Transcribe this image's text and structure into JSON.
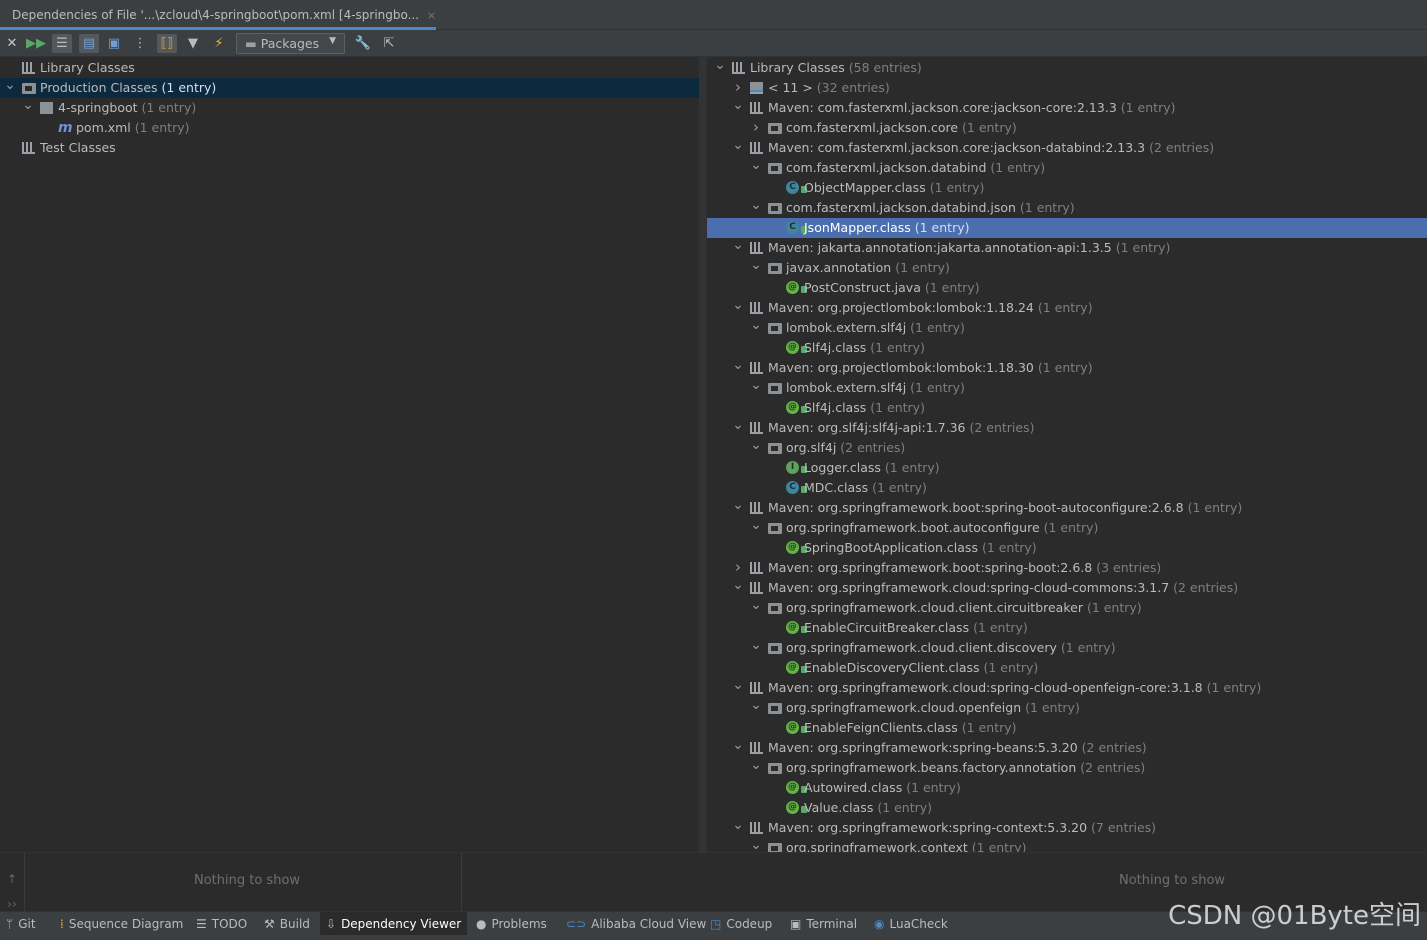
{
  "tab": {
    "title": "Dependencies of File '...\\zcloud\\4-springboot\\pom.xml [4-springbo...",
    "close": "×"
  },
  "toolbar": {
    "packages_label": "Packages"
  },
  "left_tree": [
    {
      "label": "Library Classes",
      "count": "",
      "level": 0,
      "arrow": "",
      "icon": "library"
    },
    {
      "label": "Production Classes",
      "count": "(1 entry)",
      "level": 0,
      "arrow": "down",
      "icon": "folder",
      "selected": true
    },
    {
      "label": "4-springboot",
      "count": "(1 entry)",
      "level": 1,
      "arrow": "down",
      "icon": "module"
    },
    {
      "label": "pom.xml",
      "count": "(1 entry)",
      "level": 2,
      "arrow": "",
      "icon": "maven"
    },
    {
      "label": "Test Classes",
      "count": "",
      "level": 0,
      "arrow": "",
      "icon": "library"
    }
  ],
  "right_tree": [
    {
      "label": "Library Classes",
      "count": "(58 entries)",
      "level": 0,
      "arrow": "down",
      "icon": "library"
    },
    {
      "label": "< 11 >",
      "count": "(32 entries)",
      "level": 1,
      "arrow": "right",
      "icon": "jdk"
    },
    {
      "label": "Maven: com.fasterxml.jackson.core:jackson-core:2.13.3",
      "count": "(1 entry)",
      "level": 1,
      "arrow": "down",
      "icon": "library"
    },
    {
      "label": "com.fasterxml.jackson.core",
      "count": "(1 entry)",
      "level": 2,
      "arrow": "right",
      "icon": "folder"
    },
    {
      "label": "Maven: com.fasterxml.jackson.core:jackson-databind:2.13.3",
      "count": "(2 entries)",
      "level": 1,
      "arrow": "down",
      "icon": "library"
    },
    {
      "label": "com.fasterxml.jackson.databind",
      "count": "(1 entry)",
      "level": 2,
      "arrow": "down",
      "icon": "folder"
    },
    {
      "label": "ObjectMapper.class",
      "count": "(1 entry)",
      "level": 3,
      "arrow": "",
      "icon": "class"
    },
    {
      "label": "com.fasterxml.jackson.databind.json",
      "count": "(1 entry)",
      "level": 2,
      "arrow": "down",
      "icon": "folder"
    },
    {
      "label": "JsonMapper.class",
      "count": "(1 entry)",
      "level": 3,
      "arrow": "",
      "icon": "class",
      "selected": true
    },
    {
      "label": "Maven: jakarta.annotation:jakarta.annotation-api:1.3.5",
      "count": "(1 entry)",
      "level": 1,
      "arrow": "down",
      "icon": "library"
    },
    {
      "label": "javax.annotation",
      "count": "(1 entry)",
      "level": 2,
      "arrow": "down",
      "icon": "folder"
    },
    {
      "label": "PostConstruct.java",
      "count": "(1 entry)",
      "level": 3,
      "arrow": "",
      "icon": "annotation"
    },
    {
      "label": "Maven: org.projectlombok:lombok:1.18.24",
      "count": "(1 entry)",
      "level": 1,
      "arrow": "down",
      "icon": "library"
    },
    {
      "label": "lombok.extern.slf4j",
      "count": "(1 entry)",
      "level": 2,
      "arrow": "down",
      "icon": "folder"
    },
    {
      "label": "Slf4j.class",
      "count": "(1 entry)",
      "level": 3,
      "arrow": "",
      "icon": "annotation"
    },
    {
      "label": "Maven: org.projectlombok:lombok:1.18.30",
      "count": "(1 entry)",
      "level": 1,
      "arrow": "down",
      "icon": "library"
    },
    {
      "label": "lombok.extern.slf4j",
      "count": "(1 entry)",
      "level": 2,
      "arrow": "down",
      "icon": "folder"
    },
    {
      "label": "Slf4j.class",
      "count": "(1 entry)",
      "level": 3,
      "arrow": "",
      "icon": "annotation"
    },
    {
      "label": "Maven: org.slf4j:slf4j-api:1.7.36",
      "count": "(2 entries)",
      "level": 1,
      "arrow": "down",
      "icon": "library"
    },
    {
      "label": "org.slf4j",
      "count": "(2 entries)",
      "level": 2,
      "arrow": "down",
      "icon": "folder"
    },
    {
      "label": "Logger.class",
      "count": "(1 entry)",
      "level": 3,
      "arrow": "",
      "icon": "interface"
    },
    {
      "label": "MDC.class",
      "count": "(1 entry)",
      "level": 3,
      "arrow": "",
      "icon": "class"
    },
    {
      "label": "Maven: org.springframework.boot:spring-boot-autoconfigure:2.6.8",
      "count": "(1 entry)",
      "level": 1,
      "arrow": "down",
      "icon": "library"
    },
    {
      "label": "org.springframework.boot.autoconfigure",
      "count": "(1 entry)",
      "level": 2,
      "arrow": "down",
      "icon": "folder"
    },
    {
      "label": "SpringBootApplication.class",
      "count": "(1 entry)",
      "level": 3,
      "arrow": "",
      "icon": "annotation"
    },
    {
      "label": "Maven: org.springframework.boot:spring-boot:2.6.8",
      "count": "(3 entries)",
      "level": 1,
      "arrow": "right",
      "icon": "library"
    },
    {
      "label": "Maven: org.springframework.cloud:spring-cloud-commons:3.1.7",
      "count": "(2 entries)",
      "level": 1,
      "arrow": "down",
      "icon": "library"
    },
    {
      "label": "org.springframework.cloud.client.circuitbreaker",
      "count": "(1 entry)",
      "level": 2,
      "arrow": "down",
      "icon": "folder"
    },
    {
      "label": "EnableCircuitBreaker.class",
      "count": "(1 entry)",
      "level": 3,
      "arrow": "",
      "icon": "annotation"
    },
    {
      "label": "org.springframework.cloud.client.discovery",
      "count": "(1 entry)",
      "level": 2,
      "arrow": "down",
      "icon": "folder"
    },
    {
      "label": "EnableDiscoveryClient.class",
      "count": "(1 entry)",
      "level": 3,
      "arrow": "",
      "icon": "annotation"
    },
    {
      "label": "Maven: org.springframework.cloud:spring-cloud-openfeign-core:3.1.8",
      "count": "(1 entry)",
      "level": 1,
      "arrow": "down",
      "icon": "library"
    },
    {
      "label": "org.springframework.cloud.openfeign",
      "count": "(1 entry)",
      "level": 2,
      "arrow": "down",
      "icon": "folder"
    },
    {
      "label": "EnableFeignClients.class",
      "count": "(1 entry)",
      "level": 3,
      "arrow": "",
      "icon": "annotation"
    },
    {
      "label": "Maven: org.springframework:spring-beans:5.3.20",
      "count": "(2 entries)",
      "level": 1,
      "arrow": "down",
      "icon": "library"
    },
    {
      "label": "org.springframework.beans.factory.annotation",
      "count": "(2 entries)",
      "level": 2,
      "arrow": "down",
      "icon": "folder"
    },
    {
      "label": "Autowired.class",
      "count": "(1 entry)",
      "level": 3,
      "arrow": "",
      "icon": "annotation"
    },
    {
      "label": "Value.class",
      "count": "(1 entry)",
      "level": 3,
      "arrow": "",
      "icon": "annotation"
    },
    {
      "label": "Maven: org.springframework:spring-context:5.3.20",
      "count": "(7 entries)",
      "level": 1,
      "arrow": "down",
      "icon": "library"
    },
    {
      "label": "org.springframework.context",
      "count": "(1 entry)",
      "level": 2,
      "arrow": "down",
      "icon": "folder"
    }
  ],
  "bottom": {
    "left_empty": "Nothing to show",
    "right_empty": "Nothing to show"
  },
  "statusbar": [
    {
      "label": "Git",
      "icon": "git-icon"
    },
    {
      "label": "Sequence Diagram",
      "icon": "sequence-diagram-icon"
    },
    {
      "label": "TODO",
      "icon": "todo-icon"
    },
    {
      "label": "Build",
      "icon": "hammer-icon"
    },
    {
      "label": "Dependency Viewer",
      "icon": "dependency-icon",
      "active": true
    },
    {
      "label": "Problems",
      "icon": "problems-icon"
    },
    {
      "label": "Alibaba Cloud View",
      "icon": "alibaba-cloud-icon"
    },
    {
      "label": "Codeup",
      "icon": "codeup-icon"
    },
    {
      "label": "Terminal",
      "icon": "terminal-icon"
    },
    {
      "label": "LuaCheck",
      "icon": "luacheck-icon"
    }
  ],
  "watermark": "CSDN @01Byte空间",
  "colors": {
    "selection": "#4b6eaf",
    "class_icon": "#3e86a0",
    "annotation_icon": "#62b543",
    "interface_icon": "#5ea35a"
  }
}
